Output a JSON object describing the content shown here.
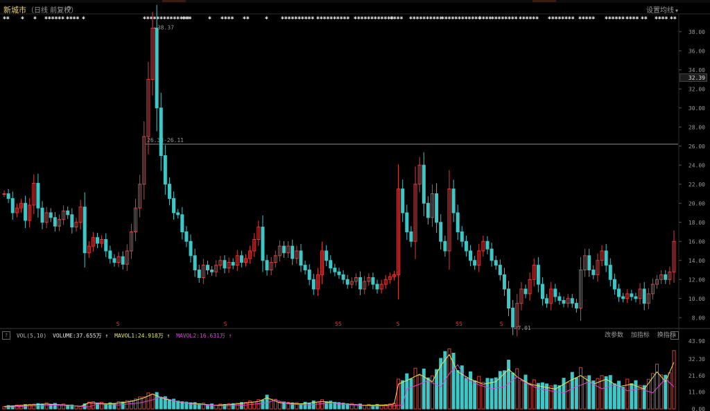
{
  "header": {
    "title": "新城市",
    "subtitle": "（日线 前复权）",
    "gear_icon": "gear-icon",
    "ma_settings_label": "设置均线",
    "ma_settings_arrow": "▾"
  },
  "colors": {
    "up": "#e23b3b",
    "down": "#3fc6c6",
    "ma1": "#e8e84a",
    "ma2": "#d946d9",
    "grid": "#2a2a2a",
    "background": "#000000"
  },
  "price_axis": {
    "ticks": [
      "38.00",
      "36.00",
      "34.00",
      "32.00",
      "30.00",
      "28.00",
      "26.00",
      "24.00",
      "22.00",
      "20.00",
      "18.00",
      "16.00",
      "14.00",
      "12.00",
      "10.00",
      "8.00"
    ],
    "current_price": "32.39"
  },
  "annotations": {
    "high_label": "←38.37",
    "low_label": "←7.01",
    "range_label": "26.33-26.11"
  },
  "event_markers": [
    "S",
    "S",
    "SS",
    "S",
    "SS",
    "S"
  ],
  "volume": {
    "indicator_label": "VOL(5,10)",
    "volume_label": "VOLUME:37.655万",
    "ma1_label": "MAVOL1:24.918万",
    "ma2_label": "MAVOL2:16.631万",
    "up_arrow": "↑",
    "help_icon": "?",
    "buttons": [
      "改参数",
      "加指标",
      "换指标"
    ],
    "close_icon": "✕",
    "axis_ticks": [
      "43.90",
      "32.30",
      "21.60",
      "11.00",
      "0.00"
    ]
  },
  "chart_data": {
    "type": "candlestick",
    "title": "新城市",
    "ylim": [
      7.0,
      39.0
    ],
    "price_path": [
      [
        0,
        21.0
      ],
      [
        1,
        20.5
      ],
      [
        2,
        19.0
      ],
      [
        3,
        19.5
      ],
      [
        4,
        20.0
      ],
      [
        5,
        18.2
      ],
      [
        6,
        19.8
      ],
      [
        7,
        22.1
      ],
      [
        8,
        19.5
      ],
      [
        9,
        18.0
      ],
      [
        10,
        19.0
      ],
      [
        11,
        18.5
      ],
      [
        12,
        17.6
      ],
      [
        13,
        18.3
      ],
      [
        14,
        19.2
      ],
      [
        15,
        18.8
      ],
      [
        16,
        17.5
      ],
      [
        17,
        18.0
      ],
      [
        18,
        19.6
      ],
      [
        19,
        14.8
      ],
      [
        20,
        15.5
      ],
      [
        21,
        16.4
      ],
      [
        22,
        15.8
      ],
      [
        23,
        16.2
      ],
      [
        24,
        15.0
      ],
      [
        25,
        14.2
      ],
      [
        26,
        13.8
      ],
      [
        27,
        14.4
      ],
      [
        28,
        13.6
      ],
      [
        29,
        15.0
      ],
      [
        30,
        17.0
      ],
      [
        31,
        19.5
      ],
      [
        32,
        22.0
      ],
      [
        33,
        27.0
      ],
      [
        34,
        33.0
      ],
      [
        35,
        38.37
      ],
      [
        36,
        30.0
      ],
      [
        37,
        25.0
      ],
      [
        38,
        22.0
      ],
      [
        39,
        20.5
      ],
      [
        40,
        19.0
      ],
      [
        41,
        18.8
      ],
      [
        42,
        17.0
      ],
      [
        43,
        16.0
      ],
      [
        44,
        14.5
      ],
      [
        45,
        13.0
      ],
      [
        46,
        12.2
      ],
      [
        47,
        13.5
      ],
      [
        48,
        13.0
      ],
      [
        49,
        12.8
      ],
      [
        50,
        13.5
      ],
      [
        51,
        14.0
      ],
      [
        52,
        13.2
      ],
      [
        53,
        13.8
      ],
      [
        54,
        13.5
      ],
      [
        55,
        14.5
      ],
      [
        56,
        13.8
      ],
      [
        57,
        14.2
      ],
      [
        58,
        15.0
      ],
      [
        59,
        16.2
      ],
      [
        60,
        17.5
      ],
      [
        61,
        14.0
      ],
      [
        62,
        13.0
      ],
      [
        63,
        13.8
      ],
      [
        64,
        14.5
      ],
      [
        65,
        15.5
      ],
      [
        66,
        14.8
      ],
      [
        67,
        15.5
      ],
      [
        68,
        14.2
      ],
      [
        69,
        15.0
      ],
      [
        70,
        13.5
      ],
      [
        71,
        13.0
      ],
      [
        72,
        12.0
      ],
      [
        73,
        11.0
      ],
      [
        74,
        12.5
      ],
      [
        75,
        15.0
      ],
      [
        76,
        14.0
      ],
      [
        77,
        13.2
      ],
      [
        78,
        12.8
      ],
      [
        79,
        12.5
      ],
      [
        80,
        12.0
      ],
      [
        81,
        11.5
      ],
      [
        82,
        11.8
      ],
      [
        83,
        12.2
      ],
      [
        84,
        11.0
      ],
      [
        85,
        11.8
      ],
      [
        86,
        12.2
      ],
      [
        87,
        11.5
      ],
      [
        88,
        11.0
      ],
      [
        89,
        11.5
      ],
      [
        90,
        12.0
      ],
      [
        91,
        12.3
      ],
      [
        92,
        12.5
      ],
      [
        93,
        21.5
      ],
      [
        94,
        19.0
      ],
      [
        95,
        17.0
      ],
      [
        96,
        16.0
      ],
      [
        97,
        22.0
      ],
      [
        98,
        24.0
      ],
      [
        99,
        20.0
      ],
      [
        100,
        18.5
      ],
      [
        101,
        21.0
      ],
      [
        102,
        18.0
      ],
      [
        103,
        16.0
      ],
      [
        104,
        15.0
      ],
      [
        105,
        21.5
      ],
      [
        106,
        19.0
      ],
      [
        107,
        17.0
      ],
      [
        108,
        16.0
      ],
      [
        109,
        15.0
      ],
      [
        110,
        14.0
      ],
      [
        111,
        13.5
      ],
      [
        112,
        15.0
      ],
      [
        113,
        16.0
      ],
      [
        114,
        15.2
      ],
      [
        115,
        14.0
      ],
      [
        116,
        13.5
      ],
      [
        117,
        12.5
      ],
      [
        118,
        11.0
      ],
      [
        119,
        9.0
      ],
      [
        120,
        7.01
      ],
      [
        121,
        9.5
      ],
      [
        122,
        11.0
      ],
      [
        123,
        10.5
      ],
      [
        124,
        12.0
      ],
      [
        125,
        13.5
      ],
      [
        126,
        11.5
      ],
      [
        127,
        10.0
      ],
      [
        128,
        9.5
      ],
      [
        129,
        11.0
      ],
      [
        130,
        10.2
      ],
      [
        131,
        9.8
      ],
      [
        132,
        9.5
      ],
      [
        133,
        10.0
      ],
      [
        134,
        9.5
      ],
      [
        135,
        9.0
      ],
      [
        136,
        13.0
      ],
      [
        137,
        14.5
      ],
      [
        138,
        13.0
      ],
      [
        139,
        12.5
      ],
      [
        140,
        14.0
      ],
      [
        141,
        15.0
      ],
      [
        142,
        13.5
      ],
      [
        143,
        12.0
      ],
      [
        144,
        11.0
      ],
      [
        145,
        10.2
      ],
      [
        146,
        10.0
      ],
      [
        147,
        10.5
      ],
      [
        148,
        10.2
      ],
      [
        149,
        10.0
      ],
      [
        150,
        11.0
      ],
      [
        151,
        9.5
      ],
      [
        152,
        10.5
      ],
      [
        153,
        11.5
      ],
      [
        154,
        12.0
      ],
      [
        155,
        12.5
      ],
      [
        156,
        12.0
      ],
      [
        157,
        12.8
      ],
      [
        158,
        16.0
      ]
    ],
    "volume_peaks": [
      [
        0,
        2
      ],
      [
        5,
        3
      ],
      [
        10,
        4
      ],
      [
        15,
        3
      ],
      [
        18,
        2
      ],
      [
        20,
        5
      ],
      [
        25,
        4
      ],
      [
        30,
        6
      ],
      [
        33,
        9
      ],
      [
        35,
        12
      ],
      [
        38,
        8
      ],
      [
        42,
        5
      ],
      [
        46,
        4
      ],
      [
        50,
        3
      ],
      [
        55,
        4
      ],
      [
        60,
        6
      ],
      [
        62,
        9
      ],
      [
        65,
        5
      ],
      [
        70,
        4
      ],
      [
        75,
        6
      ],
      [
        80,
        4
      ],
      [
        85,
        3
      ],
      [
        90,
        3
      ],
      [
        92,
        4
      ],
      [
        93,
        20
      ],
      [
        95,
        23
      ],
      [
        98,
        28
      ],
      [
        101,
        22
      ],
      [
        103,
        35
      ],
      [
        105,
        43.9
      ],
      [
        107,
        30
      ],
      [
        110,
        24
      ],
      [
        113,
        20
      ],
      [
        116,
        22
      ],
      [
        119,
        32
      ],
      [
        121,
        26
      ],
      [
        124,
        20
      ],
      [
        127,
        18
      ],
      [
        130,
        16
      ],
      [
        133,
        22
      ],
      [
        136,
        27
      ],
      [
        139,
        20
      ],
      [
        142,
        24
      ],
      [
        145,
        18
      ],
      [
        148,
        20
      ],
      [
        151,
        16
      ],
      [
        154,
        30
      ],
      [
        156,
        22
      ],
      [
        158,
        37.7
      ]
    ]
  }
}
